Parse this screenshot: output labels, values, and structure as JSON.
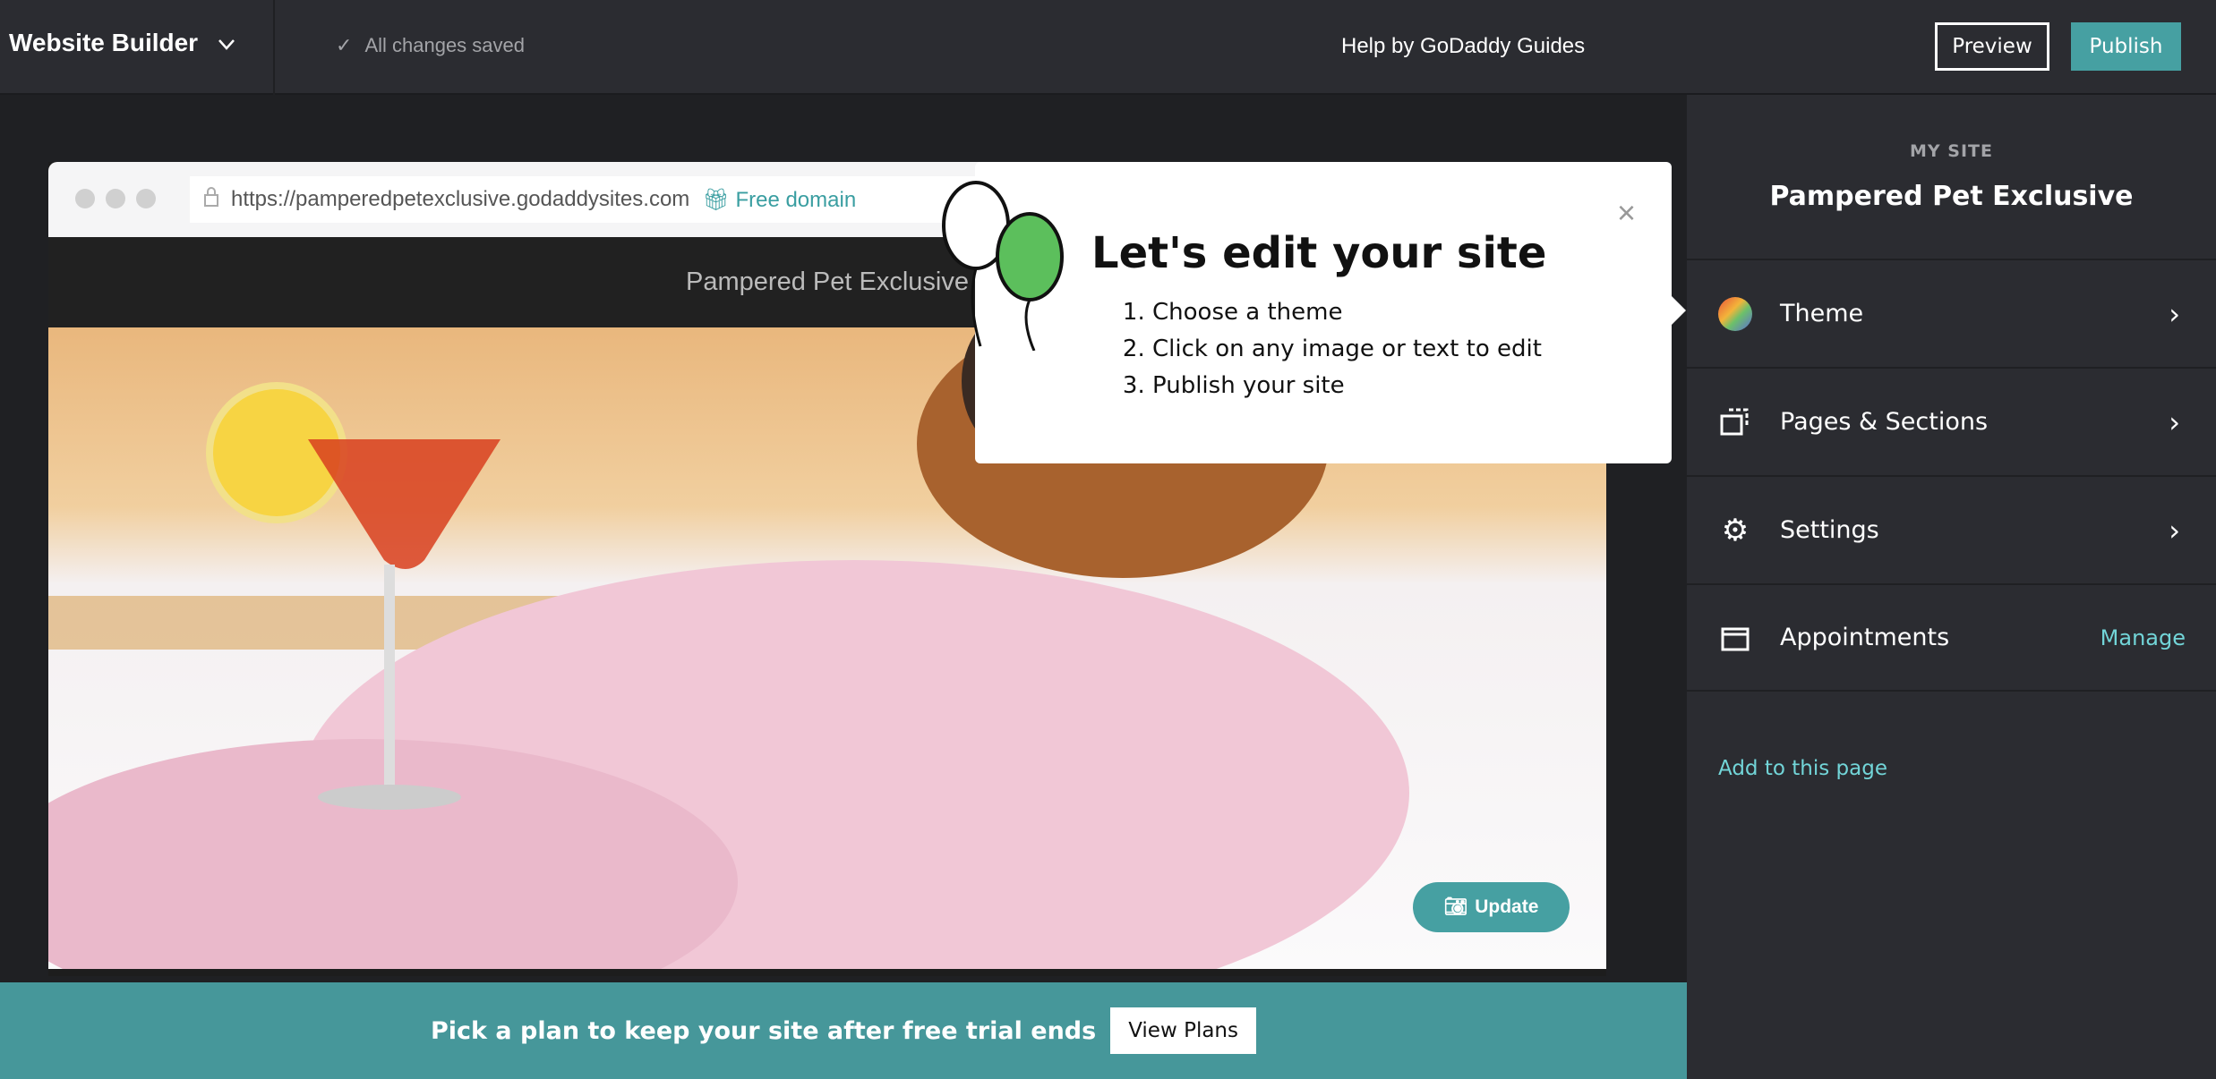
{
  "topbar": {
    "brand": "Website Builder",
    "saved_status": "All changes saved",
    "help": "Help by GoDaddy Guides",
    "preview": "Preview",
    "publish": "Publish"
  },
  "panel": {
    "label": "MY SITE",
    "site_name": "Pampered Pet Exclusive",
    "items": [
      {
        "label": "Theme",
        "icon": "color-wheel-icon"
      },
      {
        "label": "Pages & Sections",
        "icon": "pages-icon"
      },
      {
        "label": "Settings",
        "icon": "gear-icon"
      },
      {
        "label": "Appointments",
        "icon": "calendar-icon",
        "action": "Manage"
      }
    ],
    "add_to_page": "Add to this page"
  },
  "preview": {
    "url": "https://pamperedpetexclusive.godaddysites.com",
    "free_domain": "Free domain",
    "site_title": "Pampered Pet Exclusive",
    "update": "Update"
  },
  "popup": {
    "title": "Let's edit your site",
    "steps": [
      "Choose a theme",
      "Click on any image or text to edit",
      "Publish your site"
    ],
    "close": "×"
  },
  "banner": {
    "text": "Pick a plan to keep your site after free trial ends",
    "button": "View Plans"
  },
  "colors": {
    "accent": "#46a0a2",
    "link": "#72d5d8",
    "panel": "#2b2c31"
  }
}
